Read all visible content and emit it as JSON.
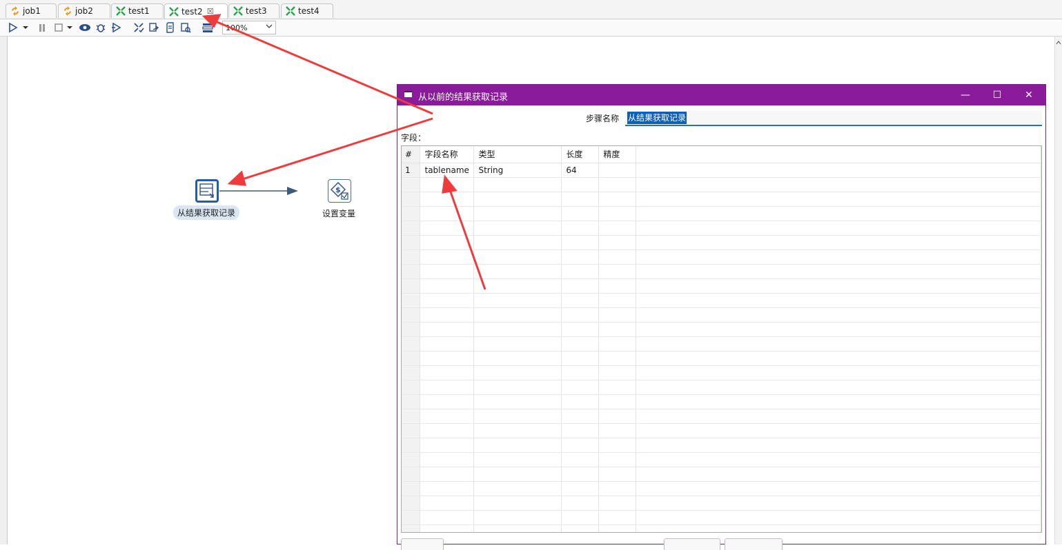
{
  "tabs": [
    {
      "label": "job1",
      "kind": "job",
      "active": false
    },
    {
      "label": "job2",
      "kind": "job",
      "active": false
    },
    {
      "label": "test1",
      "kind": "transformation",
      "active": false
    },
    {
      "label": "test2",
      "kind": "transformation",
      "active": true,
      "close": "☒"
    },
    {
      "label": "test3",
      "kind": "transformation",
      "active": false
    },
    {
      "label": "test4",
      "kind": "transformation",
      "active": false
    }
  ],
  "toolbar": {
    "zoom_value": "100%",
    "icons": [
      "run-icon",
      "run-options-dropdown-icon",
      "pause-icon",
      "stop-icon",
      "stop-dropdown-icon",
      "preview-icon",
      "debug-icon",
      "replay-icon",
      "verify-icon",
      "impact-icon",
      "sql-icon",
      "explore-db-icon",
      "show-results-icon"
    ]
  },
  "canvas": {
    "nodes": [
      {
        "label": "从结果获取记录",
        "icon": "get-rows-from-result-icon",
        "selected": true
      },
      {
        "label": "设置变量",
        "icon": "set-variables-icon",
        "selected": false
      }
    ]
  },
  "dialog": {
    "title": "从以前的结果获取记录",
    "step_name_label": "步骤名称",
    "step_name_value": "从结果获取记录",
    "fields_label": "字段：",
    "columns": [
      "#",
      "字段名称",
      "类型",
      "长度",
      "精度"
    ],
    "rows": [
      {
        "num": "1",
        "name": "tablename",
        "type": "String",
        "length": "64",
        "precision": ""
      }
    ],
    "window_buttons": {
      "minimize": "—",
      "maximize": "☐",
      "close": "✕"
    }
  },
  "colors": {
    "dialog_title_bg": "#8a1b9b",
    "annotation_arrow": "#ee3b3b",
    "selection_blue": "#0e5fb8",
    "node_border_selected": "#1f5fa8"
  }
}
